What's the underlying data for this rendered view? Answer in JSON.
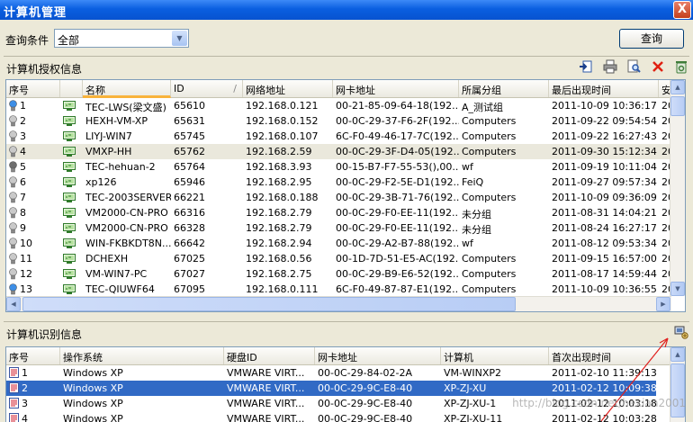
{
  "window": {
    "title": "计算机管理",
    "close_label": "X"
  },
  "query": {
    "label": "查询条件",
    "selected": "全部",
    "button": "查询"
  },
  "auth_section": {
    "title": "计算机授权信息",
    "toolbar": [
      "import-icon",
      "print-icon",
      "preview-icon",
      "delete-icon",
      "recycle-icon"
    ],
    "columns": [
      "序号",
      "名称",
      "ID",
      "网络地址",
      "网卡地址",
      "所属分组",
      "最后出现时间",
      "安"
    ],
    "rows": [
      {
        "no": "1",
        "status": "online",
        "name": "TEC-LWS(梁文盛)",
        "id": "65610",
        "ip": "192.168.0.121",
        "mac": "00-21-85-09-64-18(192...",
        "group": "A_测试组",
        "time": "2011-10-09 10:36:17",
        "extra": "20"
      },
      {
        "no": "2",
        "status": "offline",
        "name": "HEXH-VM-XP",
        "id": "65631",
        "ip": "192.168.0.152",
        "mac": "00-0C-29-37-F6-2F(192...",
        "group": "Computers",
        "time": "2011-09-22 09:54:54",
        "extra": "20"
      },
      {
        "no": "3",
        "status": "offline",
        "name": "LIYJ-WIN7",
        "id": "65745",
        "ip": "192.168.0.107",
        "mac": "6C-F0-49-46-17-7C(192...",
        "group": "Computers",
        "time": "2011-09-22 16:27:43",
        "extra": "20"
      },
      {
        "no": "4",
        "status": "offline",
        "name": "VMXP-HH",
        "id": "65762",
        "ip": "192.168.2.59",
        "mac": "00-0C-29-3F-D4-05(192...",
        "group": "Computers",
        "time": "2011-09-30 15:12:34",
        "extra": "20"
      },
      {
        "no": "5",
        "status": "dark",
        "name": "TEC-hehuan-2",
        "id": "65764",
        "ip": "192.168.3.93",
        "mac": "00-15-B7-F7-55-53(),00...",
        "group": "wf",
        "time": "2011-09-19 10:11:04",
        "extra": "20"
      },
      {
        "no": "6",
        "status": "offline",
        "name": "xp126",
        "id": "65946",
        "ip": "192.168.2.95",
        "mac": "00-0C-29-F2-5E-D1(192...",
        "group": "FeiQ",
        "time": "2011-09-27 09:57:34",
        "extra": "20"
      },
      {
        "no": "7",
        "status": "offline",
        "name": "TEC-2003SERVER",
        "id": "66221",
        "ip": "192.168.0.188",
        "mac": "00-0C-29-3B-71-76(192...",
        "group": "Computers",
        "time": "2011-10-09 09:36:09",
        "extra": "20"
      },
      {
        "no": "8",
        "status": "offline",
        "name": "VM2000-CN-PRO",
        "id": "66316",
        "ip": "192.168.2.79",
        "mac": "00-0C-29-F0-EE-11(192...",
        "group": "未分组",
        "time": "2011-08-31 14:04:21",
        "extra": "20"
      },
      {
        "no": "9",
        "status": "offline",
        "name": "VM2000-CN-PRO",
        "id": "66328",
        "ip": "192.168.2.79",
        "mac": "00-0C-29-F0-EE-11(192...",
        "group": "未分组",
        "time": "2011-08-24 16:27:17",
        "extra": "20"
      },
      {
        "no": "10",
        "status": "offline",
        "name": "WIN-FKBKDT8N...",
        "id": "66642",
        "ip": "192.168.2.94",
        "mac": "00-0C-29-A2-B7-88(192...",
        "group": "wf",
        "time": "2011-08-12 09:53:34",
        "extra": "20"
      },
      {
        "no": "11",
        "status": "offline",
        "name": "DCHEXH",
        "id": "67025",
        "ip": "192.168.0.56",
        "mac": "00-1D-7D-51-E5-AC(192...",
        "group": "Computers",
        "time": "2011-09-15 16:57:00",
        "extra": "20"
      },
      {
        "no": "12",
        "status": "offline",
        "name": "VM-WIN7-PC",
        "id": "67027",
        "ip": "192.168.2.75",
        "mac": "00-0C-29-B9-E6-52(192...",
        "group": "Computers",
        "time": "2011-08-17 14:59:44",
        "extra": "20"
      },
      {
        "no": "13",
        "status": "online",
        "name": "TEC-QIUWF64",
        "id": "67095",
        "ip": "192.168.0.111",
        "mac": "6C-F0-49-87-87-E1(192...",
        "group": "Computers",
        "time": "2011-10-09 10:36:55",
        "extra": "20"
      }
    ]
  },
  "ident_section": {
    "title": "计算机识别信息",
    "toolbar": [
      "scan-computers-icon"
    ],
    "columns": [
      "序号",
      "操作系统",
      "硬盘ID",
      "网卡地址",
      "计算机",
      "首次出现时间"
    ],
    "rows": [
      {
        "no": "1",
        "os": "Windows XP",
        "disk": "VMWARE VIRT...",
        "mac": "00-0C-29-84-02-2A",
        "pc": "VM-WINXP2",
        "time": "2011-02-10 11:39:13"
      },
      {
        "no": "2",
        "os": "Windows XP",
        "disk": "VMWARE VIRT...",
        "mac": "00-0C-29-9C-E8-40",
        "pc": "XP-ZJ-XU",
        "time": "2011-02-12 10:09:38"
      },
      {
        "no": "3",
        "os": "Windows XP",
        "disk": "VMWARE VIRT...",
        "mac": "00-0C-29-9C-E8-40",
        "pc": "XP-ZJ-XU-1",
        "time": "2011-02-12 10:03:18"
      },
      {
        "no": "4",
        "os": "Windows XP",
        "disk": "VMWARE VIRT...",
        "mac": "00-0C-29-9C-E8-40",
        "pc": "XP-ZJ-XU-11",
        "time": "2011-02-12 10:03:28"
      }
    ]
  },
  "watermark": "http://blog.csdn.net/hexian2001",
  "colors": {
    "title_blue": "#0a5fe0",
    "selection": "#316ac5",
    "sort_marker": "#f8b33b",
    "annotation_arrow": "#e0201e"
  }
}
